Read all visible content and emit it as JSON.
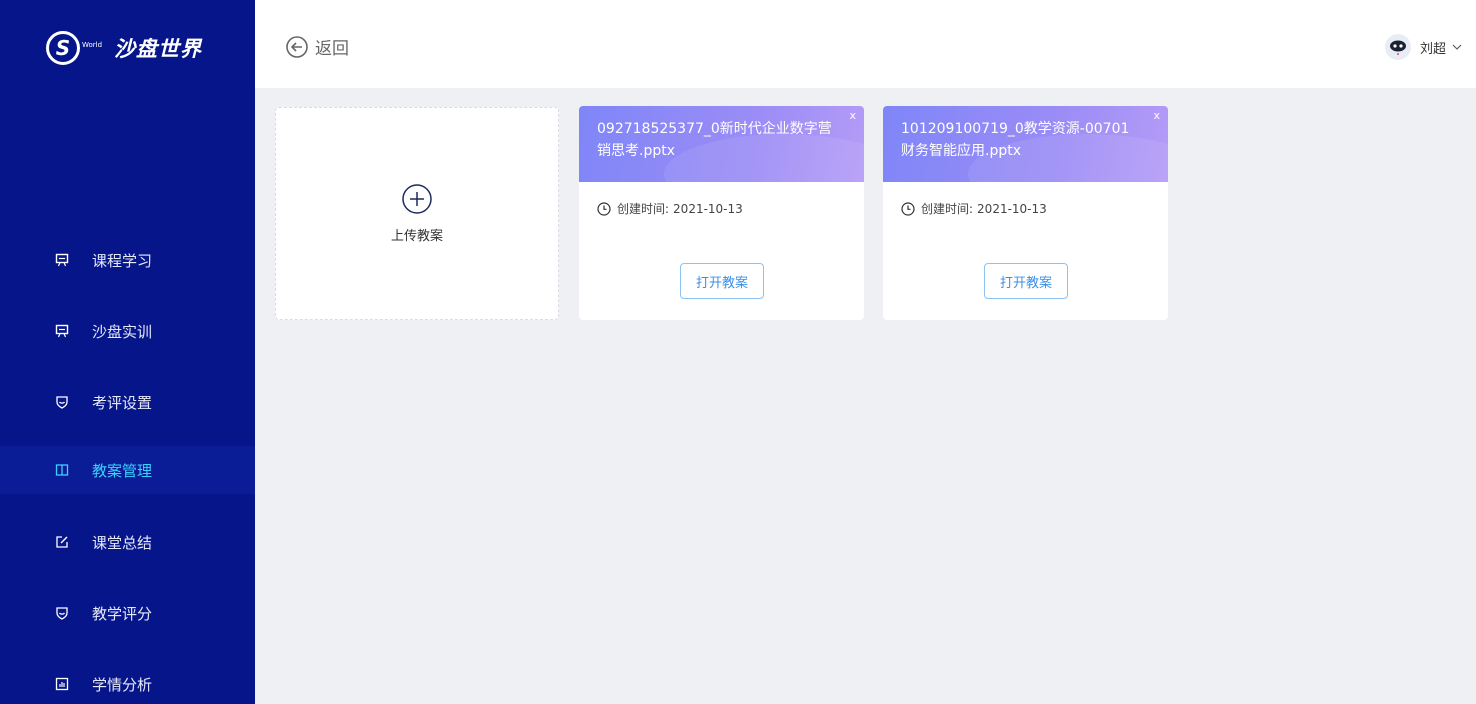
{
  "brand": {
    "mark": "S",
    "world": "World",
    "name": "沙盘世界"
  },
  "sidebar": {
    "items": [
      {
        "label": "课程学习",
        "icon": "presentation-icon"
      },
      {
        "label": "沙盘实训",
        "icon": "presentation-icon"
      },
      {
        "label": "考评设置",
        "icon": "badge-icon"
      },
      {
        "label": "教案管理",
        "icon": "book-icon",
        "active": true
      },
      {
        "label": "课堂总结",
        "icon": "edit-icon"
      },
      {
        "label": "教学评分",
        "icon": "badge-icon"
      },
      {
        "label": "学情分析",
        "icon": "chart-icon"
      }
    ]
  },
  "header": {
    "back_label": "返回",
    "user_name": "刘超"
  },
  "upload": {
    "label": "上传教案"
  },
  "files": [
    {
      "title": "092718525377_0新时代企业数字营销思考.pptx",
      "time_label": "创建时间:",
      "time": "2021-10-13",
      "open_label": "打开教案",
      "close": "x"
    },
    {
      "title": "101209100719_0教学资源-00701财务智能应用.pptx",
      "time_label": "创建时间:",
      "time": "2021-10-13",
      "open_label": "打开教案",
      "close": "x"
    }
  ],
  "colors": {
    "sidebar": "#06168a",
    "active_text": "#3ad2ff",
    "card_gradient_start": "#7f86f8",
    "card_gradient_end": "#b49cf7",
    "button_text": "#3d8fe6"
  }
}
